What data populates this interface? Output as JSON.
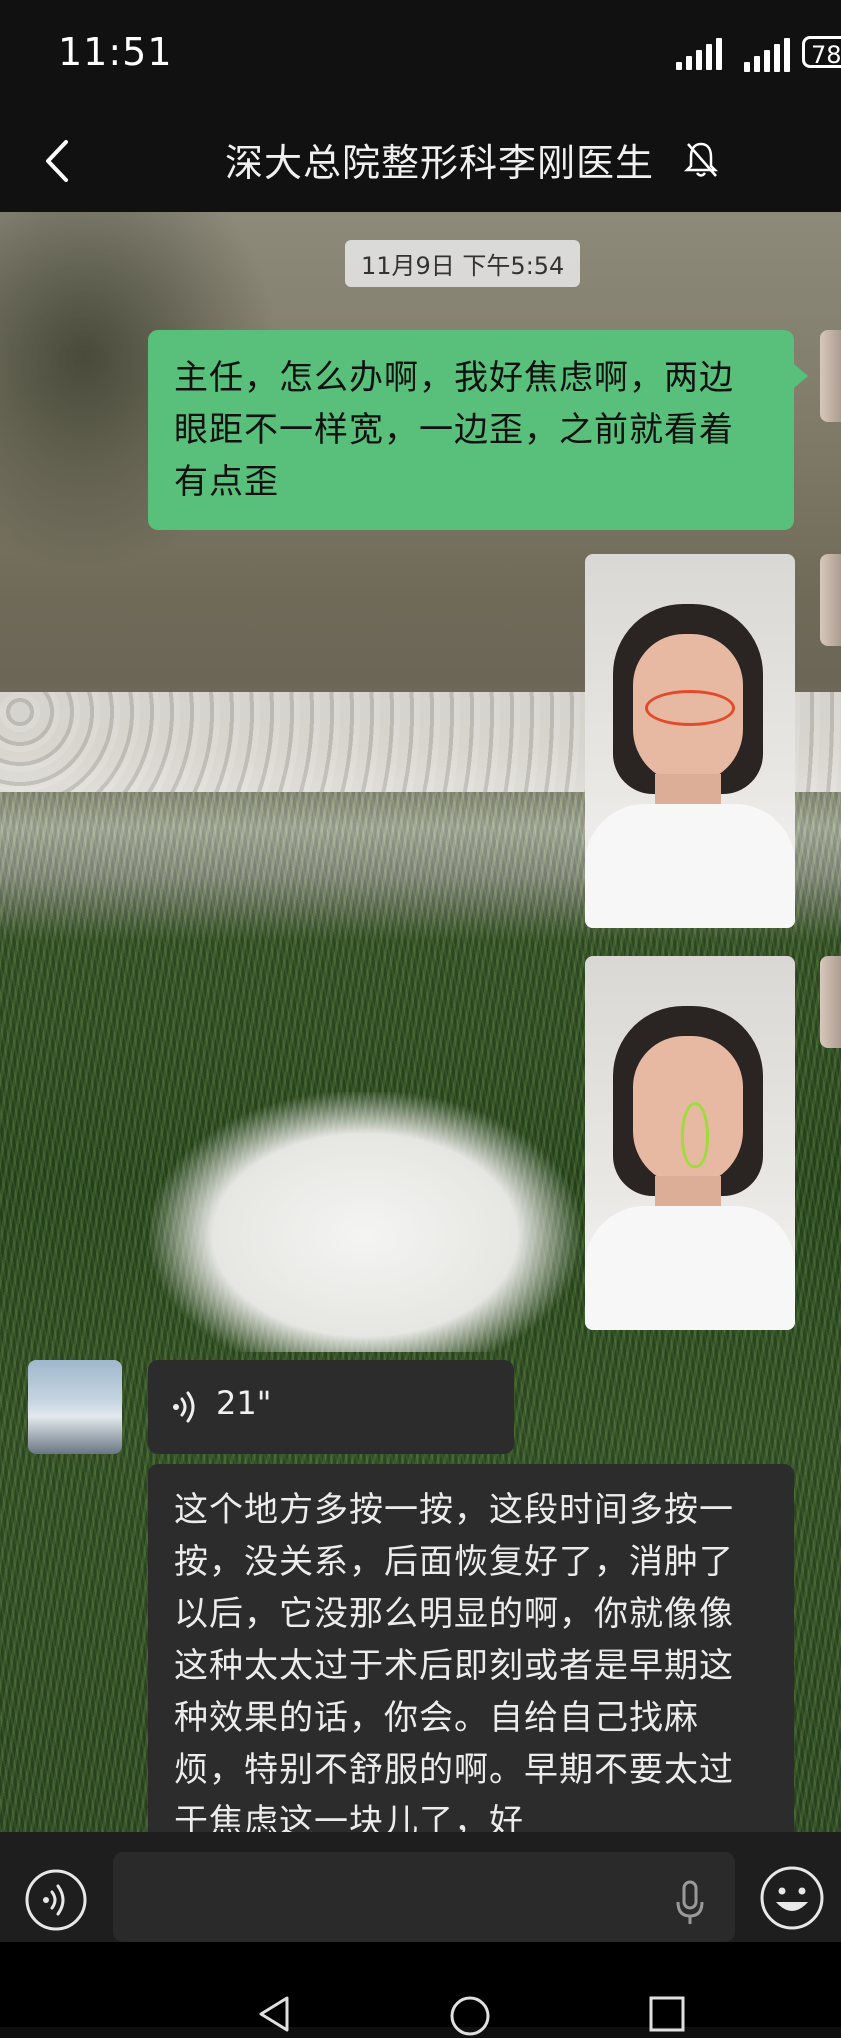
{
  "status_bar": {
    "time": "11:51",
    "battery": "78",
    "icons": [
      "signal-1-icon",
      "signal-2-icon",
      "battery-icon"
    ]
  },
  "header": {
    "back_icon": "chevron-left-icon",
    "title": "深大总院整形科李刚医生",
    "mute_icon": "bell-off-icon"
  },
  "chat": {
    "timestamp": "11月9日 下午5:54",
    "messages": [
      {
        "direction": "outgoing",
        "type": "text",
        "text": "主任，怎么办啊，我好焦虑啊，两边眼距不一样宽，一边歪，之前就看着有点歪"
      },
      {
        "direction": "outgoing",
        "type": "image",
        "annotation_color": "#e24a2a"
      },
      {
        "direction": "outgoing",
        "type": "image",
        "annotation_color": "#9edc3d"
      },
      {
        "direction": "incoming",
        "type": "voice",
        "duration": "21\""
      },
      {
        "direction": "incoming",
        "type": "text",
        "text": "这个地方多按一按，这段时间多按一按，没关系，后面恢复好了，消肿了以后，它没那么明显的啊，你就像像这种太太过于术后即刻或者是早期这种效果的话，你会。自给自己找麻烦，特别不舒服的啊。早期不要太过于焦虑这一块儿了，好"
      }
    ]
  },
  "input_bar": {
    "voice_toggle_icon": "voice-toggle-icon",
    "placeholder": "",
    "mic_icon": "microphone-icon",
    "emoji_icon": "emoji-icon"
  },
  "system_nav": {
    "icons": [
      "back-triangle-icon",
      "home-circle-icon",
      "recents-square-icon"
    ]
  },
  "colors": {
    "outgoing_bubble": "#58c07a",
    "incoming_bubble": "#2c2c2c",
    "header_bg": "#111111",
    "input_bg": "#1e1e1e"
  }
}
